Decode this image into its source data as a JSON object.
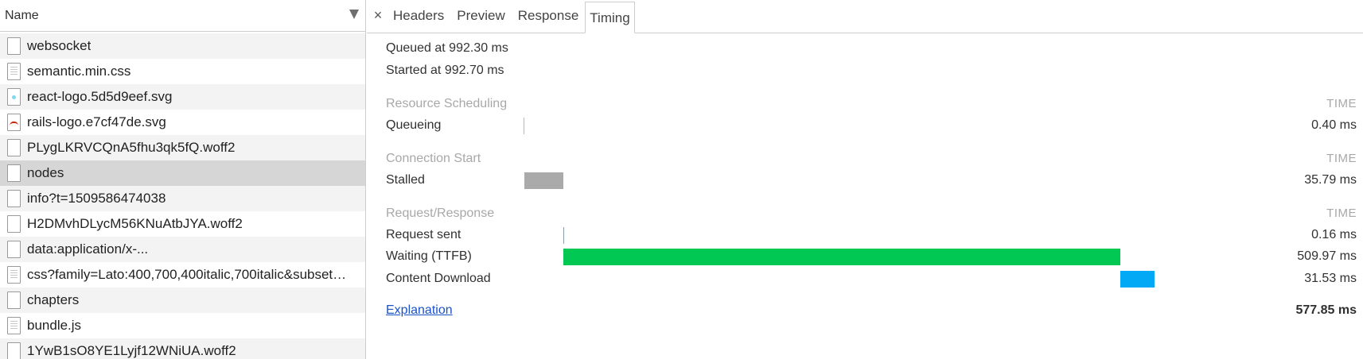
{
  "left_panel": {
    "header_label": "Name",
    "requests": [
      {
        "name": "websocket",
        "icon": "blank-file-icon",
        "selected": false
      },
      {
        "name": "semantic.min.css",
        "icon": "stylesheet-file-icon",
        "selected": false
      },
      {
        "name": "react-logo.5d5d9eef.svg",
        "icon": "react-image-icon",
        "selected": false
      },
      {
        "name": "rails-logo.e7cf47de.svg",
        "icon": "rails-image-icon",
        "selected": false
      },
      {
        "name": "PLygLKRVCQnA5fhu3qk5fQ.woff2",
        "icon": "blank-file-icon",
        "selected": false
      },
      {
        "name": "nodes",
        "icon": "blank-file-icon",
        "selected": true
      },
      {
        "name": "info?t=1509586474038",
        "icon": "blank-file-icon",
        "selected": false
      },
      {
        "name": "H2DMvhDLycM56KNuAtbJYA.woff2",
        "icon": "blank-file-icon",
        "selected": false
      },
      {
        "name": "data:application/x-...",
        "icon": "blank-file-icon",
        "selected": false
      },
      {
        "name": "css?family=Lato:400,700,400italic,700italic&subset…",
        "icon": "stylesheet-file-icon",
        "selected": false
      },
      {
        "name": "chapters",
        "icon": "blank-file-icon",
        "selected": false
      },
      {
        "name": "bundle.js",
        "icon": "script-file-icon",
        "selected": false
      },
      {
        "name": "1YwB1sO8YE1Lyjf12WNiUA.woff2",
        "icon": "blank-file-icon",
        "selected": false
      }
    ]
  },
  "tabs": {
    "close": "×",
    "headers": "Headers",
    "preview": "Preview",
    "response": "Response",
    "timing": "Timing",
    "active": "timing"
  },
  "timing": {
    "queued_at": "Queued at 992.30 ms",
    "started_at": "Started at 992.70 ms",
    "time_header": "TIME",
    "sections": [
      {
        "title": "Resource Scheduling",
        "phases": [
          {
            "label": "Queueing",
            "value": "0.40 ms",
            "kind": "tick",
            "color": "#b8b8b8",
            "start_ms": 0,
            "duration_ms": 0.4
          }
        ]
      },
      {
        "title": "Connection Start",
        "phases": [
          {
            "label": "Stalled",
            "value": "35.79 ms",
            "kind": "bar",
            "color": "#aaaaaa",
            "start_ms": 0.4,
            "duration_ms": 35.79
          }
        ]
      },
      {
        "title": "Request/Response",
        "phases": [
          {
            "label": "Request sent",
            "value": "0.16 ms",
            "kind": "tick",
            "color": "#8a9bb0",
            "start_ms": 36.19,
            "duration_ms": 0.16
          },
          {
            "label": "Waiting (TTFB)",
            "value": "509.97 ms",
            "kind": "bar",
            "color": "#00c853",
            "start_ms": 36.35,
            "duration_ms": 509.97
          },
          {
            "label": "Content Download",
            "value": "31.53 ms",
            "kind": "bar",
            "color": "#03a9f4",
            "start_ms": 546.32,
            "duration_ms": 31.53
          }
        ]
      }
    ],
    "explanation": "Explanation",
    "total": "577.85 ms",
    "total_ms": 577.85
  }
}
